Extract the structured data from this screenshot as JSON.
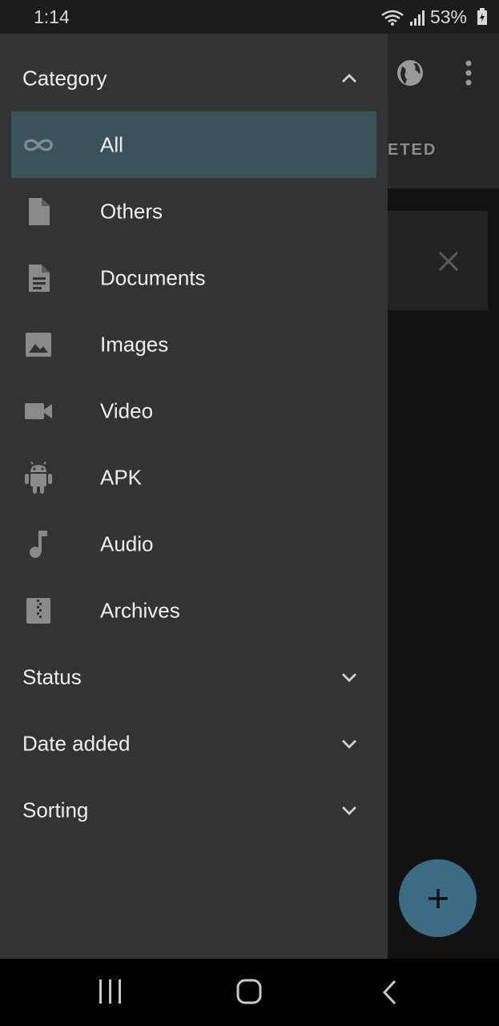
{
  "status_bar": {
    "time": "1:14",
    "battery": "53%"
  },
  "background": {
    "tab_partial": "ETED",
    "fab_icon": "plus-icon"
  },
  "drawer": {
    "category": {
      "label": "Category",
      "expanded": true
    },
    "items": [
      {
        "label": "All",
        "icon": "infinity-icon",
        "selected": true
      },
      {
        "label": "Others",
        "icon": "file-icon",
        "selected": false
      },
      {
        "label": "Documents",
        "icon": "document-icon",
        "selected": false
      },
      {
        "label": "Images",
        "icon": "image-icon",
        "selected": false
      },
      {
        "label": "Video",
        "icon": "video-icon",
        "selected": false
      },
      {
        "label": "APK",
        "icon": "android-icon",
        "selected": false
      },
      {
        "label": "Audio",
        "icon": "music-note-icon",
        "selected": false
      },
      {
        "label": "Archives",
        "icon": "archive-icon",
        "selected": false
      }
    ],
    "sections": [
      {
        "label": "Status",
        "expanded": false
      },
      {
        "label": "Date added",
        "expanded": false
      },
      {
        "label": "Sorting",
        "expanded": false
      }
    ]
  },
  "colors": {
    "drawer_bg": "#333333",
    "selected_bg": "#3a525a",
    "fab": "#3d6a85"
  }
}
